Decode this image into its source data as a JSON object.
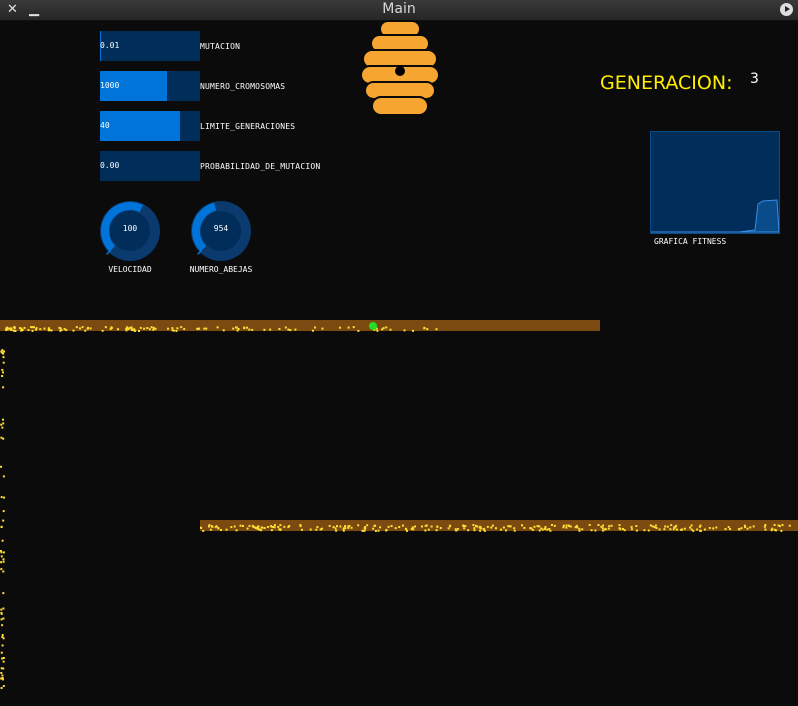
{
  "window": {
    "title": "Main",
    "close_glyph": "✕",
    "min_glyph": "▁"
  },
  "sliders": [
    {
      "label": "MUTACION",
      "value": "0.01",
      "fraction": 0.01
    },
    {
      "label": "NUMERO_CROMOSOMAS",
      "value": "1000",
      "fraction": 0.67
    },
    {
      "label": "LIMITE_GENERACIONES",
      "value": "40",
      "fraction": 0.8
    },
    {
      "label": "PROBABILIDAD_DE_MUTACION",
      "value": "0.00",
      "fraction": 0.0
    }
  ],
  "knobs": [
    {
      "label": "VELOCIDAD",
      "value": "100",
      "fraction": 0.6
    },
    {
      "label": "NUMERO_ABEJAS",
      "value": "954",
      "fraction": 0.45
    }
  ],
  "generation": {
    "label": "GENERACION:",
    "value": "3"
  },
  "chart": {
    "label": "GRAFICA FITNESS"
  },
  "colors": {
    "accent": "#0074d9",
    "track": "#002d5a",
    "bee": "#ffdd33",
    "branch": "#7a4a10",
    "hive": "#f7a531",
    "gen_label": "#ffee00",
    "best": "#22e022"
  },
  "icons": {
    "hive": "beehive-icon",
    "play": "play-icon",
    "close": "close-icon",
    "minimize": "minimize-icon"
  }
}
